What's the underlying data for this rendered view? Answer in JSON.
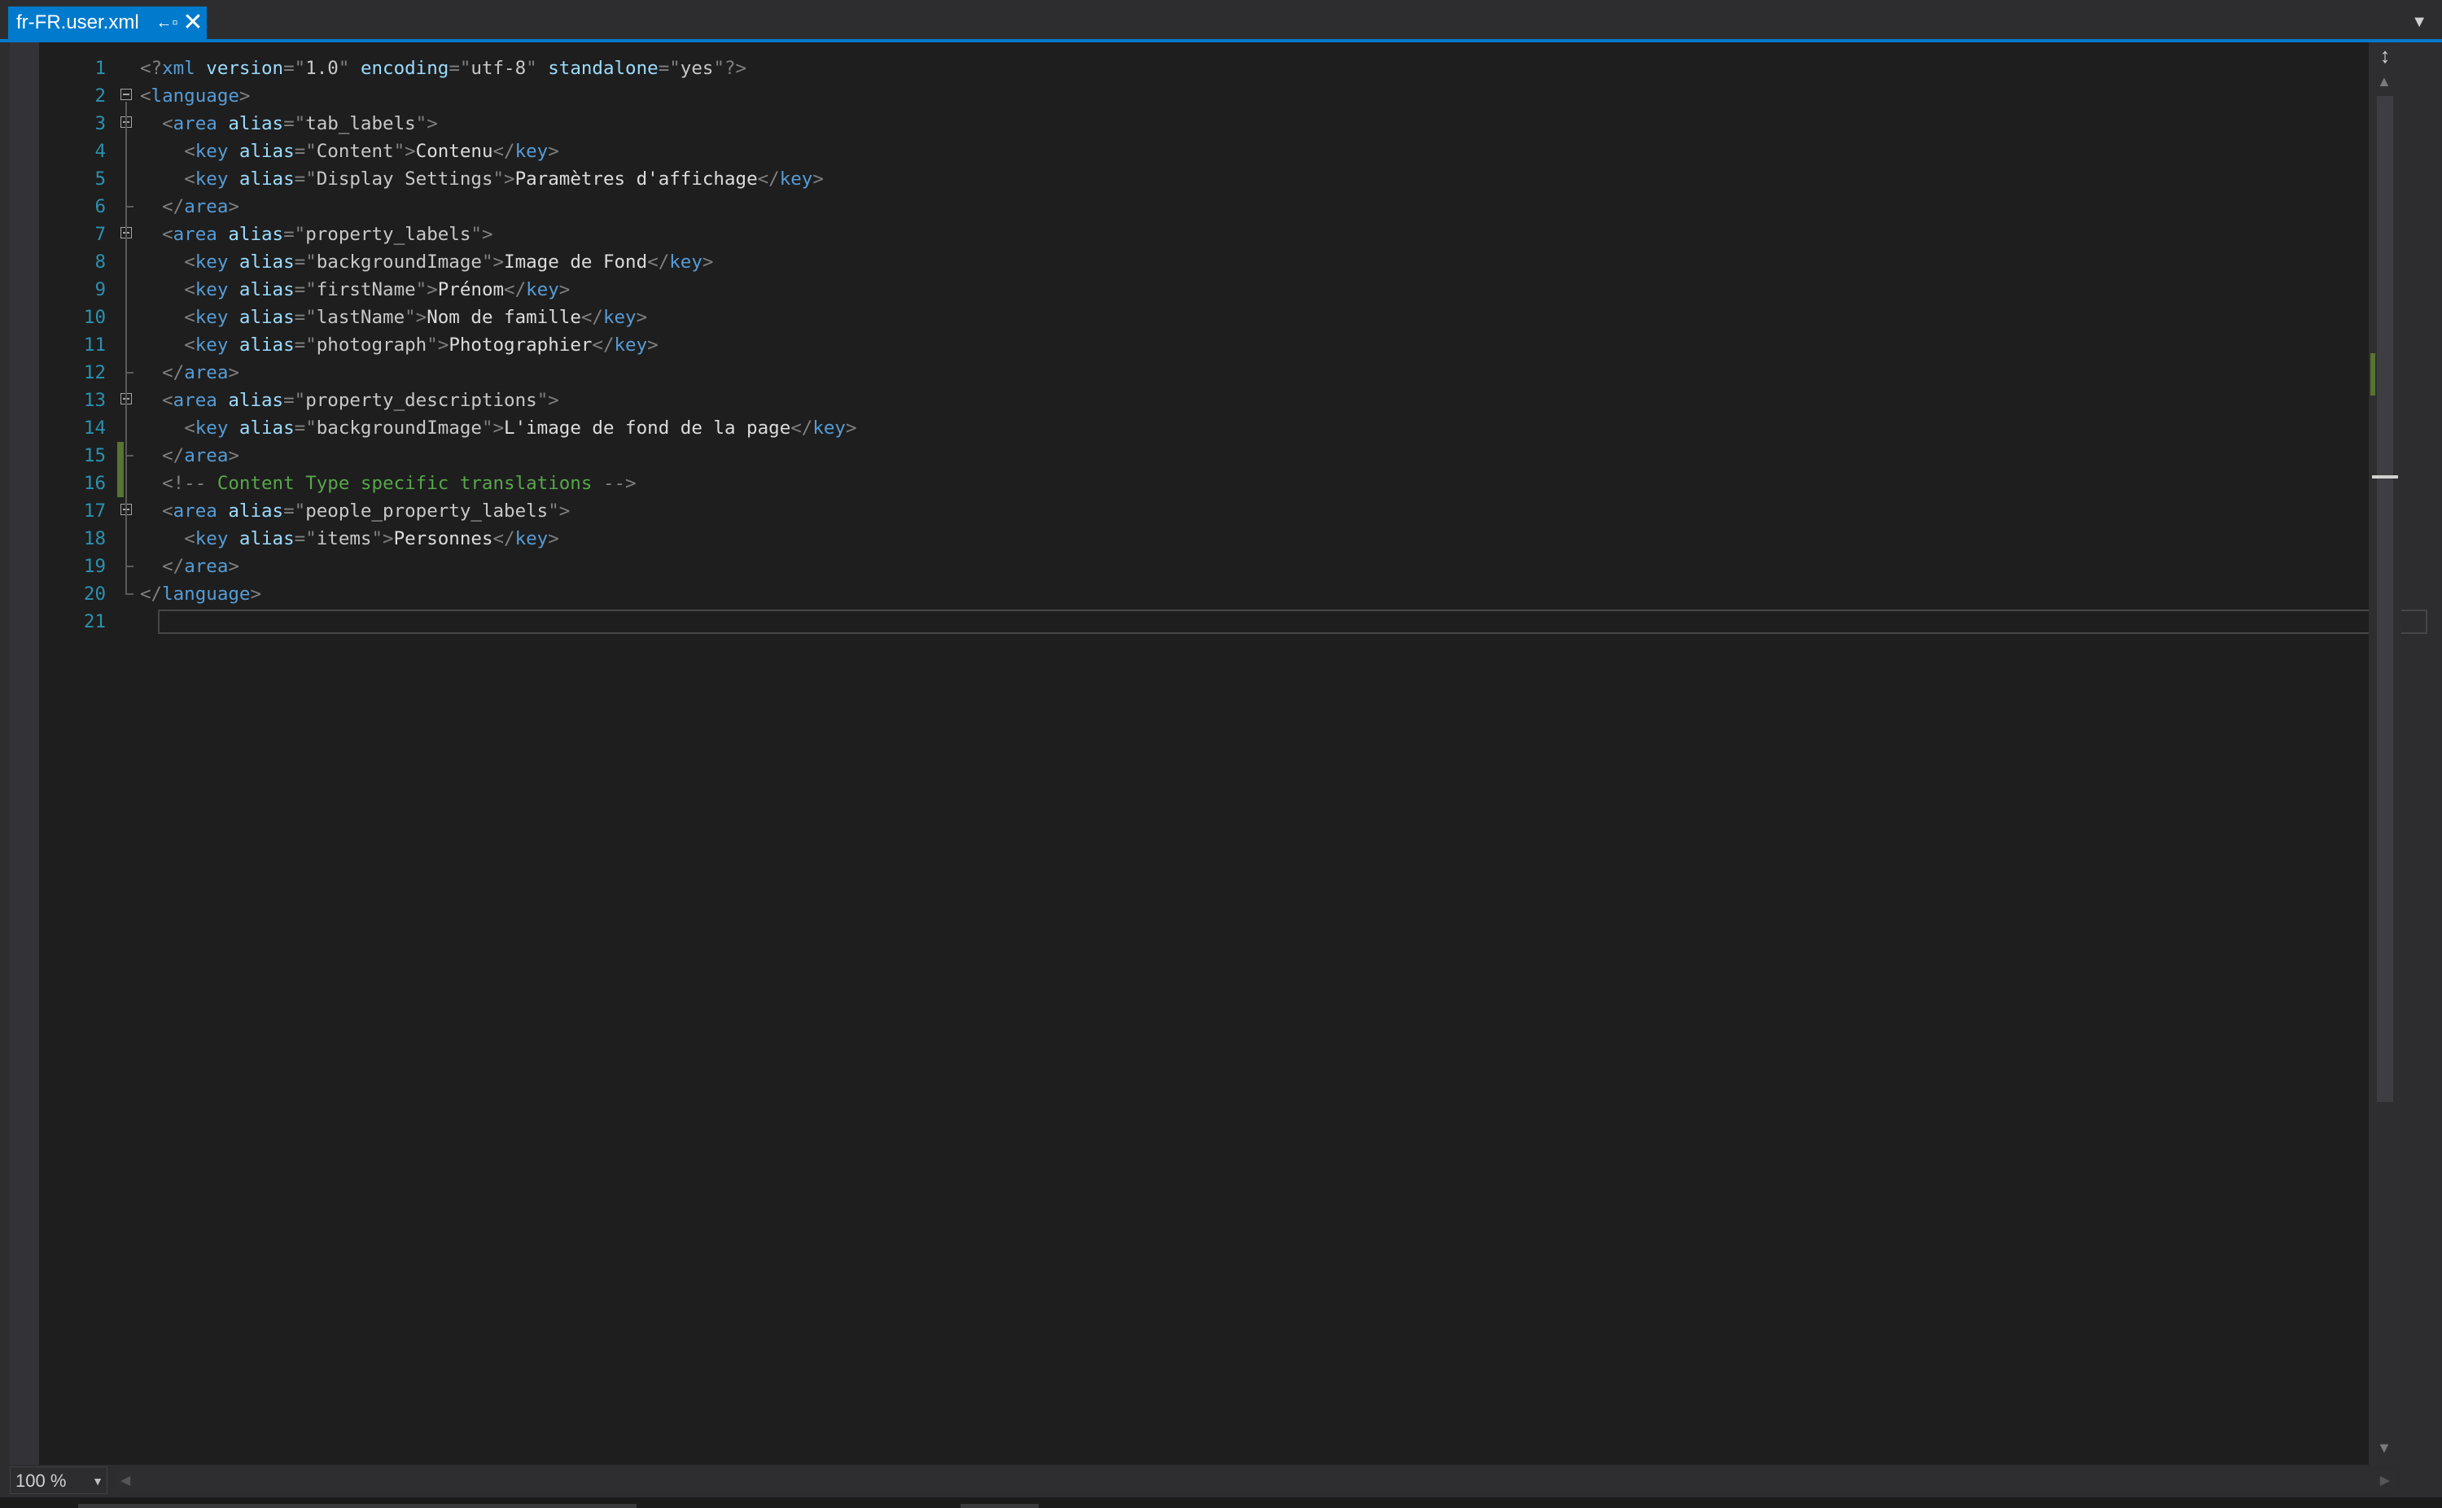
{
  "tab": {
    "title": "fr-FR.user.xml",
    "pin_icon": "←▫",
    "close_icon": "✕"
  },
  "editor": {
    "lines": [
      {
        "n": "1",
        "tokens": [
          {
            "c": "d",
            "t": "<?"
          },
          {
            "c": "t",
            "t": "xml"
          },
          {
            "c": "x",
            "t": " "
          },
          {
            "c": "a",
            "t": "version"
          },
          {
            "c": "d",
            "t": "=\""
          },
          {
            "c": "v",
            "t": "1.0"
          },
          {
            "c": "d",
            "t": "\""
          },
          {
            "c": "x",
            "t": " "
          },
          {
            "c": "a",
            "t": "encoding"
          },
          {
            "c": "d",
            "t": "=\""
          },
          {
            "c": "v",
            "t": "utf-8"
          },
          {
            "c": "d",
            "t": "\""
          },
          {
            "c": "x",
            "t": " "
          },
          {
            "c": "a",
            "t": "standalone"
          },
          {
            "c": "d",
            "t": "=\""
          },
          {
            "c": "v",
            "t": "yes"
          },
          {
            "c": "d",
            "t": "\"?>"
          }
        ]
      },
      {
        "n": "2",
        "tokens": [
          {
            "c": "d",
            "t": "<"
          },
          {
            "c": "t",
            "t": "language"
          },
          {
            "c": "d",
            "t": ">"
          }
        ]
      },
      {
        "n": "3",
        "tokens": [
          {
            "c": "x",
            "t": "  "
          },
          {
            "c": "d",
            "t": "<"
          },
          {
            "c": "t",
            "t": "area"
          },
          {
            "c": "x",
            "t": " "
          },
          {
            "c": "a",
            "t": "alias"
          },
          {
            "c": "d",
            "t": "=\""
          },
          {
            "c": "v",
            "t": "tab_labels"
          },
          {
            "c": "d",
            "t": "\">"
          }
        ]
      },
      {
        "n": "4",
        "tokens": [
          {
            "c": "x",
            "t": "    "
          },
          {
            "c": "d",
            "t": "<"
          },
          {
            "c": "t",
            "t": "key"
          },
          {
            "c": "x",
            "t": " "
          },
          {
            "c": "a",
            "t": "alias"
          },
          {
            "c": "d",
            "t": "=\""
          },
          {
            "c": "v",
            "t": "Content"
          },
          {
            "c": "d",
            "t": "\">"
          },
          {
            "c": "x",
            "t": "Contenu"
          },
          {
            "c": "d",
            "t": "</"
          },
          {
            "c": "t",
            "t": "key"
          },
          {
            "c": "d",
            "t": ">"
          }
        ]
      },
      {
        "n": "5",
        "tokens": [
          {
            "c": "x",
            "t": "    "
          },
          {
            "c": "d",
            "t": "<"
          },
          {
            "c": "t",
            "t": "key"
          },
          {
            "c": "x",
            "t": " "
          },
          {
            "c": "a",
            "t": "alias"
          },
          {
            "c": "d",
            "t": "=\""
          },
          {
            "c": "v",
            "t": "Display Settings"
          },
          {
            "c": "d",
            "t": "\">"
          },
          {
            "c": "x",
            "t": "Paramètres d'affichage"
          },
          {
            "c": "d",
            "t": "</"
          },
          {
            "c": "t",
            "t": "key"
          },
          {
            "c": "d",
            "t": ">"
          }
        ]
      },
      {
        "n": "6",
        "tokens": [
          {
            "c": "x",
            "t": "  "
          },
          {
            "c": "d",
            "t": "</"
          },
          {
            "c": "t",
            "t": "area"
          },
          {
            "c": "d",
            "t": ">"
          }
        ]
      },
      {
        "n": "7",
        "tokens": [
          {
            "c": "x",
            "t": "  "
          },
          {
            "c": "d",
            "t": "<"
          },
          {
            "c": "t",
            "t": "area"
          },
          {
            "c": "x",
            "t": " "
          },
          {
            "c": "a",
            "t": "alias"
          },
          {
            "c": "d",
            "t": "=\""
          },
          {
            "c": "v",
            "t": "property_labels"
          },
          {
            "c": "d",
            "t": "\">"
          }
        ]
      },
      {
        "n": "8",
        "tokens": [
          {
            "c": "x",
            "t": "    "
          },
          {
            "c": "d",
            "t": "<"
          },
          {
            "c": "t",
            "t": "key"
          },
          {
            "c": "x",
            "t": " "
          },
          {
            "c": "a",
            "t": "alias"
          },
          {
            "c": "d",
            "t": "=\""
          },
          {
            "c": "v",
            "t": "backgroundImage"
          },
          {
            "c": "d",
            "t": "\">"
          },
          {
            "c": "x",
            "t": "Image de Fond"
          },
          {
            "c": "d",
            "t": "</"
          },
          {
            "c": "t",
            "t": "key"
          },
          {
            "c": "d",
            "t": ">"
          }
        ]
      },
      {
        "n": "9",
        "tokens": [
          {
            "c": "x",
            "t": "    "
          },
          {
            "c": "d",
            "t": "<"
          },
          {
            "c": "t",
            "t": "key"
          },
          {
            "c": "x",
            "t": " "
          },
          {
            "c": "a",
            "t": "alias"
          },
          {
            "c": "d",
            "t": "=\""
          },
          {
            "c": "v",
            "t": "firstName"
          },
          {
            "c": "d",
            "t": "\">"
          },
          {
            "c": "x",
            "t": "Prénom"
          },
          {
            "c": "d",
            "t": "</"
          },
          {
            "c": "t",
            "t": "key"
          },
          {
            "c": "d",
            "t": ">"
          }
        ]
      },
      {
        "n": "10",
        "tokens": [
          {
            "c": "x",
            "t": "    "
          },
          {
            "c": "d",
            "t": "<"
          },
          {
            "c": "t",
            "t": "key"
          },
          {
            "c": "x",
            "t": " "
          },
          {
            "c": "a",
            "t": "alias"
          },
          {
            "c": "d",
            "t": "=\""
          },
          {
            "c": "v",
            "t": "lastName"
          },
          {
            "c": "d",
            "t": "\">"
          },
          {
            "c": "x",
            "t": "Nom de famille"
          },
          {
            "c": "d",
            "t": "</"
          },
          {
            "c": "t",
            "t": "key"
          },
          {
            "c": "d",
            "t": ">"
          }
        ]
      },
      {
        "n": "11",
        "tokens": [
          {
            "c": "x",
            "t": "    "
          },
          {
            "c": "d",
            "t": "<"
          },
          {
            "c": "t",
            "t": "key"
          },
          {
            "c": "x",
            "t": " "
          },
          {
            "c": "a",
            "t": "alias"
          },
          {
            "c": "d",
            "t": "=\""
          },
          {
            "c": "v",
            "t": "photograph"
          },
          {
            "c": "d",
            "t": "\">"
          },
          {
            "c": "x",
            "t": "Photographier"
          },
          {
            "c": "d",
            "t": "</"
          },
          {
            "c": "t",
            "t": "key"
          },
          {
            "c": "d",
            "t": ">"
          }
        ]
      },
      {
        "n": "12",
        "tokens": [
          {
            "c": "x",
            "t": "  "
          },
          {
            "c": "d",
            "t": "</"
          },
          {
            "c": "t",
            "t": "area"
          },
          {
            "c": "d",
            "t": ">"
          }
        ]
      },
      {
        "n": "13",
        "tokens": [
          {
            "c": "x",
            "t": "  "
          },
          {
            "c": "d",
            "t": "<"
          },
          {
            "c": "t",
            "t": "area"
          },
          {
            "c": "x",
            "t": " "
          },
          {
            "c": "a",
            "t": "alias"
          },
          {
            "c": "d",
            "t": "=\""
          },
          {
            "c": "v",
            "t": "property_descriptions"
          },
          {
            "c": "d",
            "t": "\">"
          }
        ]
      },
      {
        "n": "14",
        "tokens": [
          {
            "c": "x",
            "t": "    "
          },
          {
            "c": "d",
            "t": "<"
          },
          {
            "c": "t",
            "t": "key"
          },
          {
            "c": "x",
            "t": " "
          },
          {
            "c": "a",
            "t": "alias"
          },
          {
            "c": "d",
            "t": "=\""
          },
          {
            "c": "v",
            "t": "backgroundImage"
          },
          {
            "c": "d",
            "t": "\">"
          },
          {
            "c": "x",
            "t": "L'image de fond de la page"
          },
          {
            "c": "d",
            "t": "</"
          },
          {
            "c": "t",
            "t": "key"
          },
          {
            "c": "d",
            "t": ">"
          }
        ]
      },
      {
        "n": "15",
        "tokens": [
          {
            "c": "x",
            "t": "  "
          },
          {
            "c": "d",
            "t": "</"
          },
          {
            "c": "t",
            "t": "area"
          },
          {
            "c": "d",
            "t": ">"
          }
        ]
      },
      {
        "n": "16",
        "tokens": [
          {
            "c": "x",
            "t": "  "
          },
          {
            "c": "d",
            "t": "<!--"
          },
          {
            "c": "c",
            "t": " Content Type specific translations "
          },
          {
            "c": "d",
            "t": "-->"
          }
        ]
      },
      {
        "n": "17",
        "tokens": [
          {
            "c": "x",
            "t": "  "
          },
          {
            "c": "d",
            "t": "<"
          },
          {
            "c": "t",
            "t": "area"
          },
          {
            "c": "x",
            "t": " "
          },
          {
            "c": "a",
            "t": "alias"
          },
          {
            "c": "d",
            "t": "=\""
          },
          {
            "c": "v",
            "t": "people_property_labels"
          },
          {
            "c": "d",
            "t": "\">"
          }
        ]
      },
      {
        "n": "18",
        "tokens": [
          {
            "c": "x",
            "t": "    "
          },
          {
            "c": "d",
            "t": "<"
          },
          {
            "c": "t",
            "t": "key"
          },
          {
            "c": "x",
            "t": " "
          },
          {
            "c": "a",
            "t": "alias"
          },
          {
            "c": "d",
            "t": "=\""
          },
          {
            "c": "v",
            "t": "items"
          },
          {
            "c": "d",
            "t": "\">"
          },
          {
            "c": "x",
            "t": "Personnes"
          },
          {
            "c": "d",
            "t": "</"
          },
          {
            "c": "t",
            "t": "key"
          },
          {
            "c": "d",
            "t": ">"
          }
        ]
      },
      {
        "n": "19",
        "tokens": [
          {
            "c": "x",
            "t": "  "
          },
          {
            "c": "d",
            "t": "</"
          },
          {
            "c": "t",
            "t": "area"
          },
          {
            "c": "d",
            "t": ">"
          }
        ]
      },
      {
        "n": "20",
        "tokens": [
          {
            "c": "d",
            "t": "</"
          },
          {
            "c": "t",
            "t": "language"
          },
          {
            "c": "d",
            "t": ">"
          }
        ]
      },
      {
        "n": "21",
        "tokens": []
      }
    ]
  },
  "statusbar": {
    "zoom": "100 %"
  },
  "colors": {
    "accent": "#007acc",
    "editor_bg": "#1e1e1e",
    "line_number": "#2b91af",
    "tag": "#569cd6",
    "attribute": "#9cdcfe",
    "delimiter": "#808080",
    "comment": "#57a64a",
    "change_marker": "#577430"
  }
}
